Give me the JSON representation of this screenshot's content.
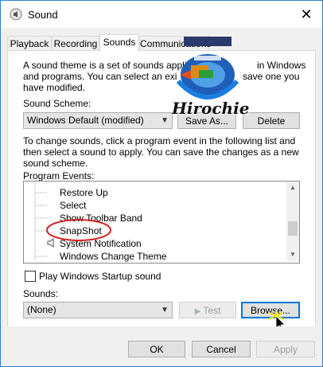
{
  "window": {
    "title": "Sound",
    "close_glyph": "✕"
  },
  "tabs": [
    {
      "label": "Playback"
    },
    {
      "label": "Recording"
    },
    {
      "label": "Sounds"
    },
    {
      "label": "Communications"
    }
  ],
  "intro_text": {
    "line1": "A sound theme is a set of sounds applie",
    "line1b": "in Windows",
    "line2": "and programs.  You can select an exi",
    "line2b": "save one you",
    "line3": "have modified."
  },
  "scheme": {
    "label": "Sound Scheme:",
    "selected": "Windows Default (modified)",
    "save_as_label": "Save As...",
    "delete_label": "Delete"
  },
  "instructions": {
    "line1": "To change sounds, click a program event in the following list and",
    "line2": "then select a sound to apply.  You can save the changes as a new",
    "line3": "sound scheme."
  },
  "program_events": {
    "label": "Program Events:",
    "items": [
      {
        "label": "Restore Up"
      },
      {
        "label": "Select"
      },
      {
        "label": "Show Toolbar Band"
      },
      {
        "label": "SnapShot"
      },
      {
        "label": "System Notification"
      },
      {
        "label": "Windows Change Theme"
      }
    ]
  },
  "startup": {
    "label": "Play Windows Startup sound",
    "checked": false
  },
  "sounds": {
    "label": "Sounds:",
    "selected": "(None)",
    "test_label": "Test",
    "browse_label": "Browse..."
  },
  "footer": {
    "ok_label": "OK",
    "cancel_label": "Cancel",
    "apply_label": "Apply"
  },
  "watermark": {
    "brand": "Hirochie"
  },
  "colors": {
    "accent": "#0078d7",
    "highlight_circle": "#d42020",
    "cursor_glow": "#f5e600"
  }
}
